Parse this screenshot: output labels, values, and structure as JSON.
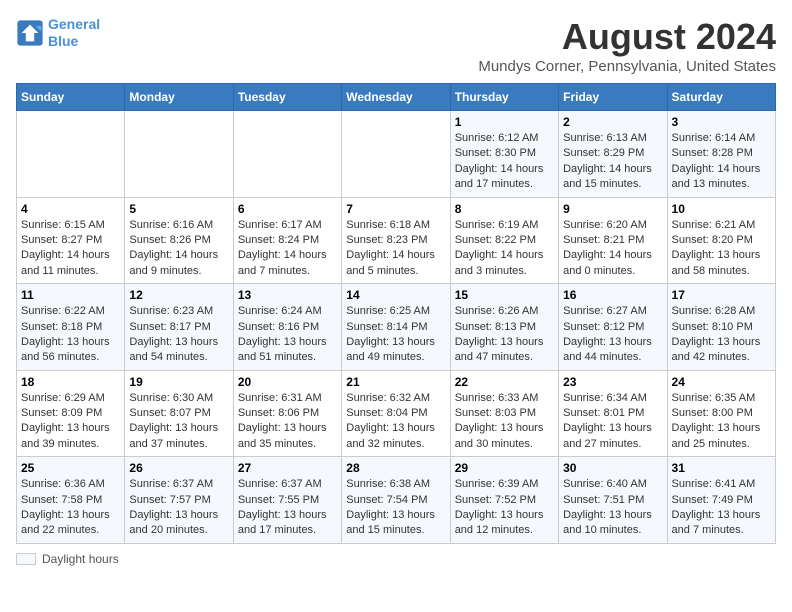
{
  "logo": {
    "line1": "General",
    "line2": "Blue"
  },
  "title": "August 2024",
  "subtitle": "Mundys Corner, Pennsylvania, United States",
  "days_of_week": [
    "Sunday",
    "Monday",
    "Tuesday",
    "Wednesday",
    "Thursday",
    "Friday",
    "Saturday"
  ],
  "weeks": [
    [
      {
        "day": "",
        "info": ""
      },
      {
        "day": "",
        "info": ""
      },
      {
        "day": "",
        "info": ""
      },
      {
        "day": "",
        "info": ""
      },
      {
        "day": "1",
        "info": "Sunrise: 6:12 AM\nSunset: 8:30 PM\nDaylight: 14 hours\nand 17 minutes."
      },
      {
        "day": "2",
        "info": "Sunrise: 6:13 AM\nSunset: 8:29 PM\nDaylight: 14 hours\nand 15 minutes."
      },
      {
        "day": "3",
        "info": "Sunrise: 6:14 AM\nSunset: 8:28 PM\nDaylight: 14 hours\nand 13 minutes."
      }
    ],
    [
      {
        "day": "4",
        "info": "Sunrise: 6:15 AM\nSunset: 8:27 PM\nDaylight: 14 hours\nand 11 minutes."
      },
      {
        "day": "5",
        "info": "Sunrise: 6:16 AM\nSunset: 8:26 PM\nDaylight: 14 hours\nand 9 minutes."
      },
      {
        "day": "6",
        "info": "Sunrise: 6:17 AM\nSunset: 8:24 PM\nDaylight: 14 hours\nand 7 minutes."
      },
      {
        "day": "7",
        "info": "Sunrise: 6:18 AM\nSunset: 8:23 PM\nDaylight: 14 hours\nand 5 minutes."
      },
      {
        "day": "8",
        "info": "Sunrise: 6:19 AM\nSunset: 8:22 PM\nDaylight: 14 hours\nand 3 minutes."
      },
      {
        "day": "9",
        "info": "Sunrise: 6:20 AM\nSunset: 8:21 PM\nDaylight: 14 hours\nand 0 minutes."
      },
      {
        "day": "10",
        "info": "Sunrise: 6:21 AM\nSunset: 8:20 PM\nDaylight: 13 hours\nand 58 minutes."
      }
    ],
    [
      {
        "day": "11",
        "info": "Sunrise: 6:22 AM\nSunset: 8:18 PM\nDaylight: 13 hours\nand 56 minutes."
      },
      {
        "day": "12",
        "info": "Sunrise: 6:23 AM\nSunset: 8:17 PM\nDaylight: 13 hours\nand 54 minutes."
      },
      {
        "day": "13",
        "info": "Sunrise: 6:24 AM\nSunset: 8:16 PM\nDaylight: 13 hours\nand 51 minutes."
      },
      {
        "day": "14",
        "info": "Sunrise: 6:25 AM\nSunset: 8:14 PM\nDaylight: 13 hours\nand 49 minutes."
      },
      {
        "day": "15",
        "info": "Sunrise: 6:26 AM\nSunset: 8:13 PM\nDaylight: 13 hours\nand 47 minutes."
      },
      {
        "day": "16",
        "info": "Sunrise: 6:27 AM\nSunset: 8:12 PM\nDaylight: 13 hours\nand 44 minutes."
      },
      {
        "day": "17",
        "info": "Sunrise: 6:28 AM\nSunset: 8:10 PM\nDaylight: 13 hours\nand 42 minutes."
      }
    ],
    [
      {
        "day": "18",
        "info": "Sunrise: 6:29 AM\nSunset: 8:09 PM\nDaylight: 13 hours\nand 39 minutes."
      },
      {
        "day": "19",
        "info": "Sunrise: 6:30 AM\nSunset: 8:07 PM\nDaylight: 13 hours\nand 37 minutes."
      },
      {
        "day": "20",
        "info": "Sunrise: 6:31 AM\nSunset: 8:06 PM\nDaylight: 13 hours\nand 35 minutes."
      },
      {
        "day": "21",
        "info": "Sunrise: 6:32 AM\nSunset: 8:04 PM\nDaylight: 13 hours\nand 32 minutes."
      },
      {
        "day": "22",
        "info": "Sunrise: 6:33 AM\nSunset: 8:03 PM\nDaylight: 13 hours\nand 30 minutes."
      },
      {
        "day": "23",
        "info": "Sunrise: 6:34 AM\nSunset: 8:01 PM\nDaylight: 13 hours\nand 27 minutes."
      },
      {
        "day": "24",
        "info": "Sunrise: 6:35 AM\nSunset: 8:00 PM\nDaylight: 13 hours\nand 25 minutes."
      }
    ],
    [
      {
        "day": "25",
        "info": "Sunrise: 6:36 AM\nSunset: 7:58 PM\nDaylight: 13 hours\nand 22 minutes."
      },
      {
        "day": "26",
        "info": "Sunrise: 6:37 AM\nSunset: 7:57 PM\nDaylight: 13 hours\nand 20 minutes."
      },
      {
        "day": "27",
        "info": "Sunrise: 6:37 AM\nSunset: 7:55 PM\nDaylight: 13 hours\nand 17 minutes."
      },
      {
        "day": "28",
        "info": "Sunrise: 6:38 AM\nSunset: 7:54 PM\nDaylight: 13 hours\nand 15 minutes."
      },
      {
        "day": "29",
        "info": "Sunrise: 6:39 AM\nSunset: 7:52 PM\nDaylight: 13 hours\nand 12 minutes."
      },
      {
        "day": "30",
        "info": "Sunrise: 6:40 AM\nSunset: 7:51 PM\nDaylight: 13 hours\nand 10 minutes."
      },
      {
        "day": "31",
        "info": "Sunrise: 6:41 AM\nSunset: 7:49 PM\nDaylight: 13 hours\nand 7 minutes."
      }
    ]
  ],
  "legend": {
    "label": "Daylight hours"
  }
}
